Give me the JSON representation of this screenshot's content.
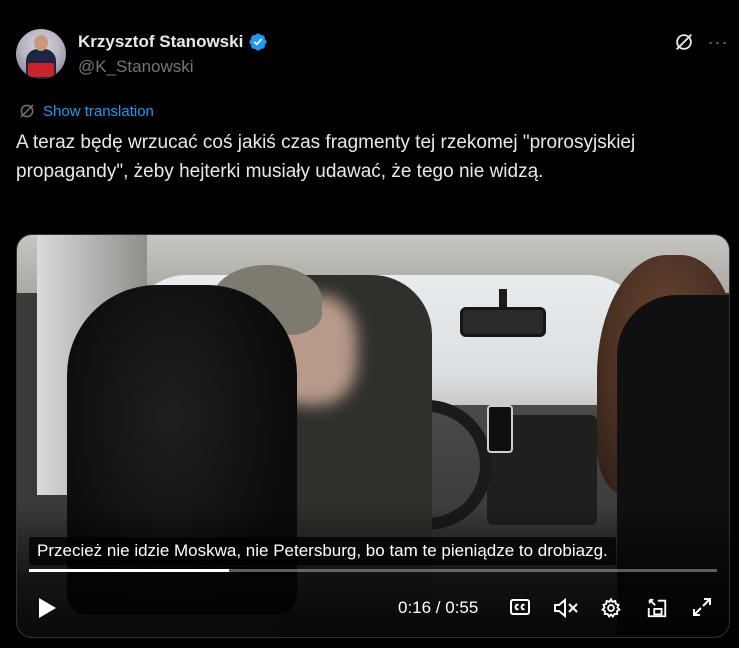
{
  "author": {
    "display_name": "Krzysztof Stanowski",
    "handle": "@K_Stanowski",
    "verified_icon": "verified-badge-icon",
    "verified_color": "#1d9bf0"
  },
  "header_actions": {
    "grok_icon": "grok-icon",
    "more_label": "···"
  },
  "translation": {
    "icon": "translate-icon",
    "label": "Show translation"
  },
  "post": {
    "text": "A teraz będę wrzucać coś jakiś czas fragmenty tej rzekomej \"prorosyjskiej propagandy\", żeby hejterki musiały udawać, że tego nie widzą."
  },
  "video": {
    "caption": "Przecież nie idzie Moskwa, nie Petersburg, bo tam te pieniądze to drobiazg.",
    "current_time": "0:16",
    "duration": "0:55",
    "time_display": "0:16 / 0:55",
    "progress_fraction": 0.29,
    "controls": {
      "play_icon": "play-icon",
      "captions_icon": "closed-captions-icon",
      "mute_icon": "volume-muted-icon",
      "settings_icon": "gear-icon",
      "pip_icon": "picture-in-picture-icon",
      "fullscreen_icon": "fullscreen-icon"
    }
  },
  "colors": {
    "background": "#000000",
    "text": "#e7e9ea",
    "secondary_text": "#71767b",
    "link": "#1d9bf0"
  }
}
